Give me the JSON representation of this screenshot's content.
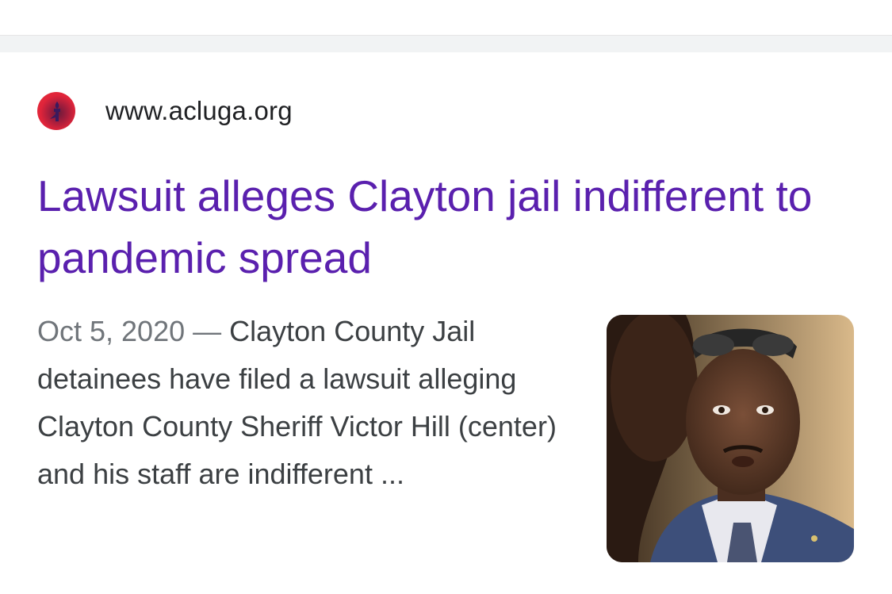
{
  "result": {
    "source": {
      "favicon": "aclu-statue-of-liberty-torch-icon",
      "url": "www.acluga.org"
    },
    "title": "Lawsuit alleges Clayton jail indifferent to pandemic spread",
    "snippet": {
      "date": "Oct 5, 2020",
      "separator": " — ",
      "text": "Clayton County Jail detainees have filed a lawsuit alleging Clayton County Sheriff Victor Hill (center) and his staff are indifferent ..."
    },
    "thumbnail": {
      "icon": "news-photo-thumbnail"
    }
  },
  "colors": {
    "title_link": "#5a20ae",
    "snippet_text": "#3c4043",
    "date_text": "#70757a",
    "url_text": "#202124",
    "favicon_red": "#e0243a"
  }
}
